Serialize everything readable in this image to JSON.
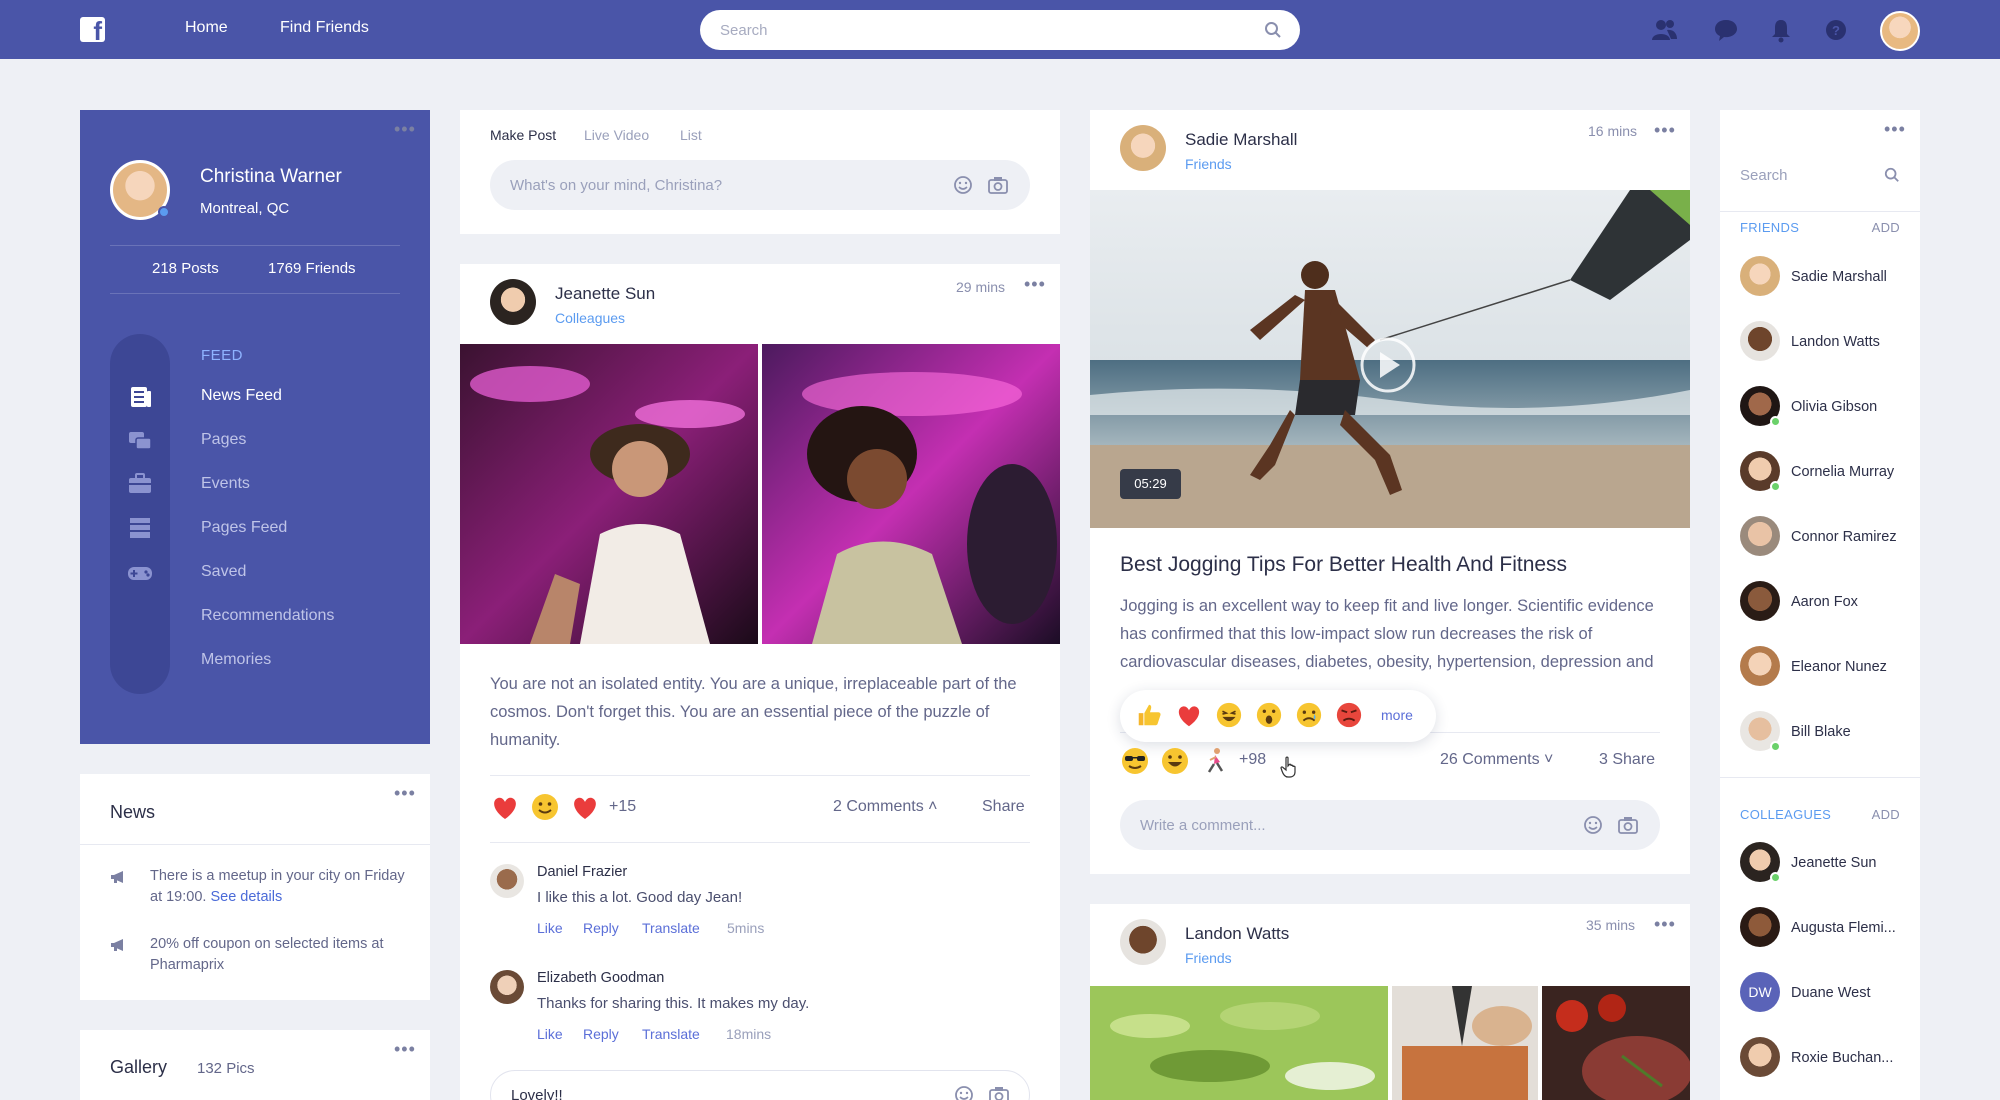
{
  "topbar": {
    "logo_letter": "f",
    "nav": [
      "Home",
      "Find Friends"
    ],
    "search_placeholder": "Search"
  },
  "profile": {
    "name": "Christina Warner",
    "city": "Montreal, QC",
    "posts": "218 Posts",
    "friends": "1769 Friends",
    "feed_label": "FEED",
    "menu": [
      "News Feed",
      "Pages",
      "Events",
      "Pages Feed",
      "Saved",
      "Recommendations",
      "Memories"
    ]
  },
  "news": {
    "title": "News",
    "item1_text": "There is a meetup in your city on Friday at 19:00.",
    "item1_link": "See details",
    "item2_text": "20% off coupon on selected items at Pharmaprix"
  },
  "gallery": {
    "title": "Gallery",
    "count": "132 Pics"
  },
  "makepost": {
    "tabs": [
      "Make Post",
      "Live Video",
      "List"
    ],
    "placeholder": "What's on your mind, Christina?"
  },
  "post1": {
    "author": "Jeanette Sun",
    "relation": "Colleagues",
    "time": "29 mins",
    "text": "You are not an isolated entity. You are a unique, irreplaceable part of the cosmos. Don't forget this. You are an essential piece of the puzzle of humanity.",
    "reaction_count": "+15",
    "comments_label": "2 Comments ˄",
    "share_label": "Share",
    "comments": [
      {
        "name": "Daniel Frazier",
        "text": "I like this a lot. Good day Jean!",
        "like": "Like",
        "reply": "Reply",
        "translate": "Translate",
        "time": "5mins"
      },
      {
        "name": "Elizabeth Goodman",
        "text": "Thanks for sharing this. It makes my day.",
        "like": "Like",
        "reply": "Reply",
        "translate": "Translate",
        "time": "18mins"
      }
    ],
    "comment_value": "Lovely!!"
  },
  "post2": {
    "author": "Sadie Marshall",
    "relation": "Friends",
    "time": "16 mins",
    "video_duration": "05:29",
    "title": "Best Jogging Tips For Better Health And Fitness",
    "text": "Jogging is an excellent way to keep fit and live longer. Scientific evidence has confirmed that this low-impact slow run decreases the risk of cardiovascular diseases, diabetes, obesity, hypertension, depression and anxiety.",
    "popup_more": "more",
    "reaction_count": "+98",
    "comments_label": "26 Comments ˅",
    "share_label": "3 Share",
    "comment_placeholder": "Write a comment..."
  },
  "post3": {
    "author": "Landon Watts",
    "relation": "Friends",
    "time": "35 mins"
  },
  "sidebar": {
    "search_placeholder": "Search",
    "friends_label": "FRIENDS",
    "colleagues_label": "COLLEAGUES",
    "add_label": "ADD",
    "friends": [
      "Sadie Marshall",
      "Landon Watts",
      "Olivia Gibson",
      "Cornelia Murray",
      "Connor Ramirez",
      "Aaron Fox",
      "Eleanor Nunez",
      "Bill Blake"
    ],
    "colleagues": [
      "Jeanette Sun",
      "Augusta Flemi...",
      "Duane West",
      "Roxie Buchan..."
    ],
    "duane_initials": "DW"
  },
  "colors": {
    "brand": "#4a55a8",
    "accent": "#5b9bf0",
    "online": "#6bd16a"
  }
}
